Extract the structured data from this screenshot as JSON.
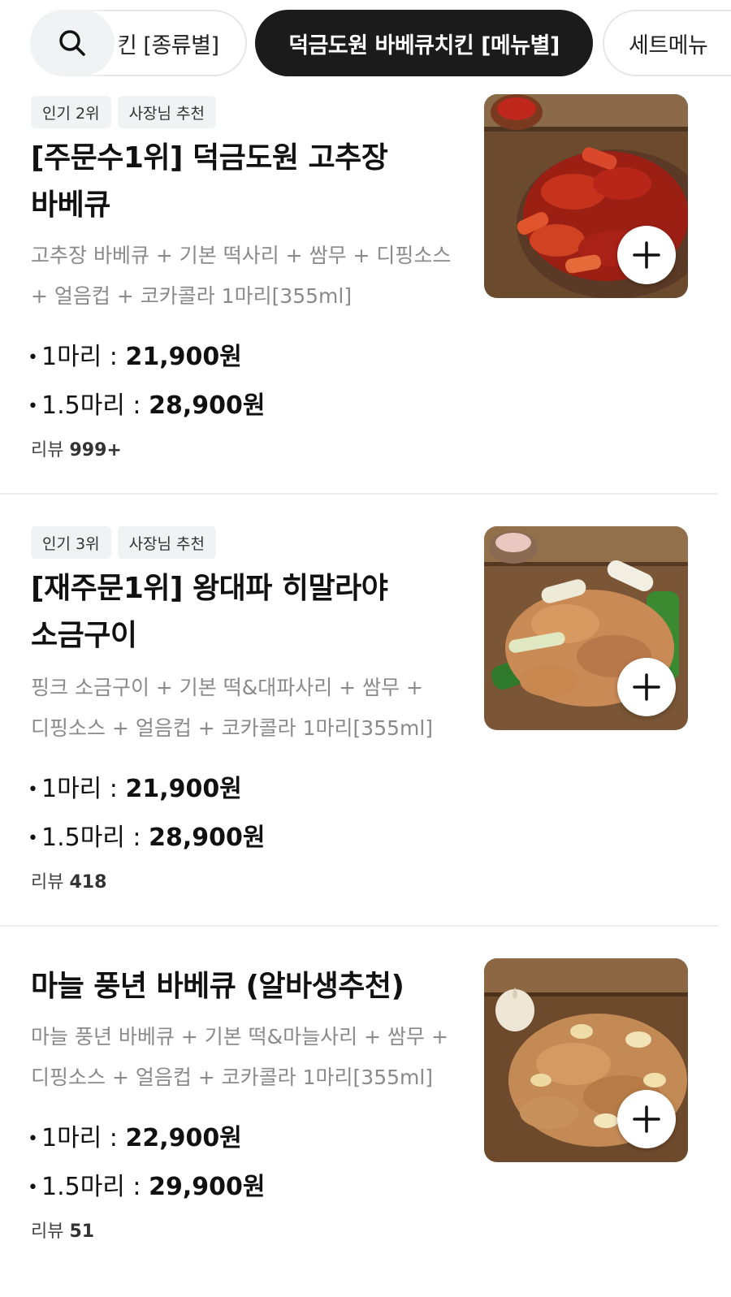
{
  "tabs": {
    "prev_label": "킨 [종류별]",
    "active_label": "덕금도원 바베큐치킨 [메뉴별]",
    "next_label": "세트메뉴"
  },
  "items": [
    {
      "badges": [
        "인기 2위",
        "사장님 추천"
      ],
      "title_line1": "[주문수1위] 덕금도원 고추장",
      "title_line2": "바베큐",
      "description": "고추장 바베큐 + 기본 떡사리 + 쌈무 + 디핑소스 + 얼음컵 + 코카콜라 1마리[355ml]",
      "prices": [
        {
          "label": "1마리 : ",
          "amount": "21,900원"
        },
        {
          "label": "1.5마리 : ",
          "amount": "28,900원"
        }
      ],
      "review_label": "리뷰 ",
      "review_count": "999+"
    },
    {
      "badges": [
        "인기 3위",
        "사장님 추천"
      ],
      "title_line1": "[재주문1위] 왕대파 히말라야",
      "title_line2": "소금구이",
      "description": "핑크 소금구이 + 기본 떡&대파사리 + 쌈무 + 디핑소스 + 얼음컵 + 코카콜라 1마리[355ml]",
      "prices": [
        {
          "label": "1마리 : ",
          "amount": "21,900원"
        },
        {
          "label": "1.5마리 : ",
          "amount": "28,900원"
        }
      ],
      "review_label": "리뷰 ",
      "review_count": "418"
    },
    {
      "badges": [],
      "title_line1": "마늘 풍년 바베큐 (알바생추천)",
      "title_line2": "",
      "description": "마늘 풍년 바베큐 + 기본 떡&마늘사리 + 쌈무 + 디핑소스 + 얼음컵 + 코카콜라 1마리[355ml]",
      "prices": [
        {
          "label": "1마리 : ",
          "amount": "22,900원"
        },
        {
          "label": "1.5마리 : ",
          "amount": "29,900원"
        }
      ],
      "review_label": "리뷰 ",
      "review_count": "51"
    }
  ],
  "icons": {
    "search": "search-icon",
    "add": "plus-icon"
  },
  "colors": {
    "active_tab_bg": "#1b1b1b",
    "badge_bg": "#f1f2f4",
    "description_text": "#8a8a8a"
  }
}
